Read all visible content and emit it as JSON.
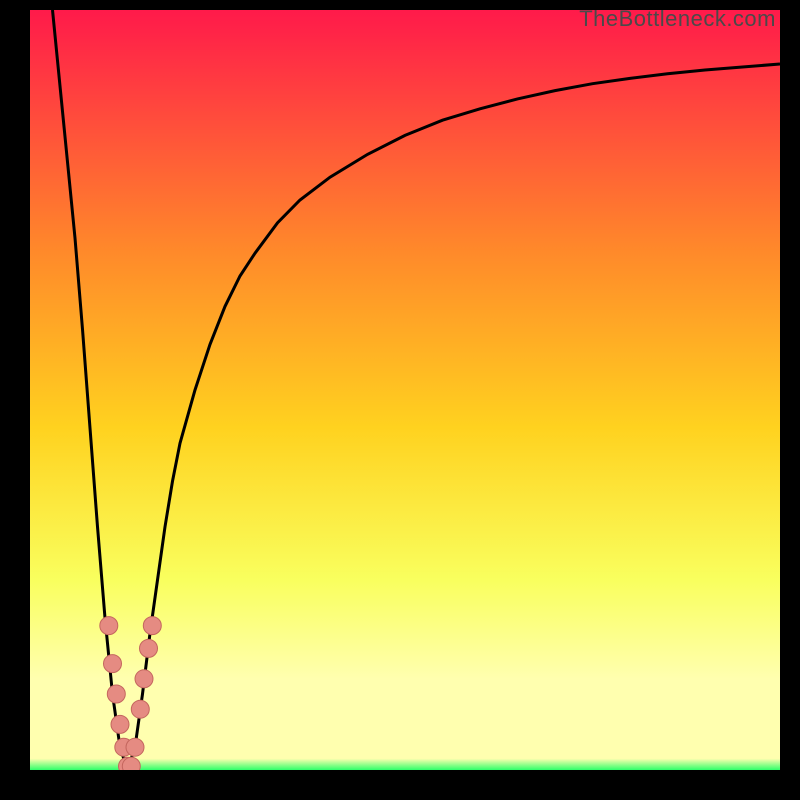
{
  "watermark": "TheBottleneck.com",
  "colors": {
    "bg": "#000000",
    "grad_top": "#ff1a4a",
    "grad_mid1": "#ff8a2a",
    "grad_mid2": "#ffd21f",
    "grad_mid3": "#f9ff5e",
    "grad_pale": "#ffffaf",
    "grad_bottom": "#2fff6a",
    "curve": "#000000",
    "dot": "#e58b82",
    "dot_stroke": "#c4665e"
  },
  "chart_data": {
    "type": "line",
    "title": "",
    "xlabel": "",
    "ylabel": "",
    "xlim": [
      0,
      100
    ],
    "ylim": [
      0,
      100
    ],
    "x": [
      3,
      4,
      5,
      6,
      7,
      8,
      9,
      10,
      11,
      12,
      13,
      14,
      15,
      16,
      17,
      18,
      19,
      20,
      22,
      24,
      26,
      28,
      30,
      33,
      36,
      40,
      45,
      50,
      55,
      60,
      65,
      70,
      75,
      80,
      85,
      90,
      95,
      100
    ],
    "values": [
      100,
      90,
      80,
      70,
      58,
      45,
      32,
      20,
      10,
      3,
      0,
      3,
      10,
      18,
      25,
      32,
      38,
      43,
      50,
      56,
      61,
      65,
      68,
      72,
      75,
      78,
      81,
      83.5,
      85.5,
      87,
      88.3,
      89.4,
      90.3,
      91,
      91.6,
      92.1,
      92.5,
      92.9
    ],
    "dots": [
      {
        "x": 10.5,
        "y": 19
      },
      {
        "x": 11,
        "y": 14
      },
      {
        "x": 11.5,
        "y": 10
      },
      {
        "x": 12,
        "y": 6
      },
      {
        "x": 12.5,
        "y": 3
      },
      {
        "x": 13,
        "y": 0.5
      },
      {
        "x": 13.5,
        "y": 0.5
      },
      {
        "x": 14,
        "y": 3
      },
      {
        "x": 14.7,
        "y": 8
      },
      {
        "x": 15.2,
        "y": 12
      },
      {
        "x": 15.8,
        "y": 16
      },
      {
        "x": 16.3,
        "y": 19
      }
    ]
  }
}
